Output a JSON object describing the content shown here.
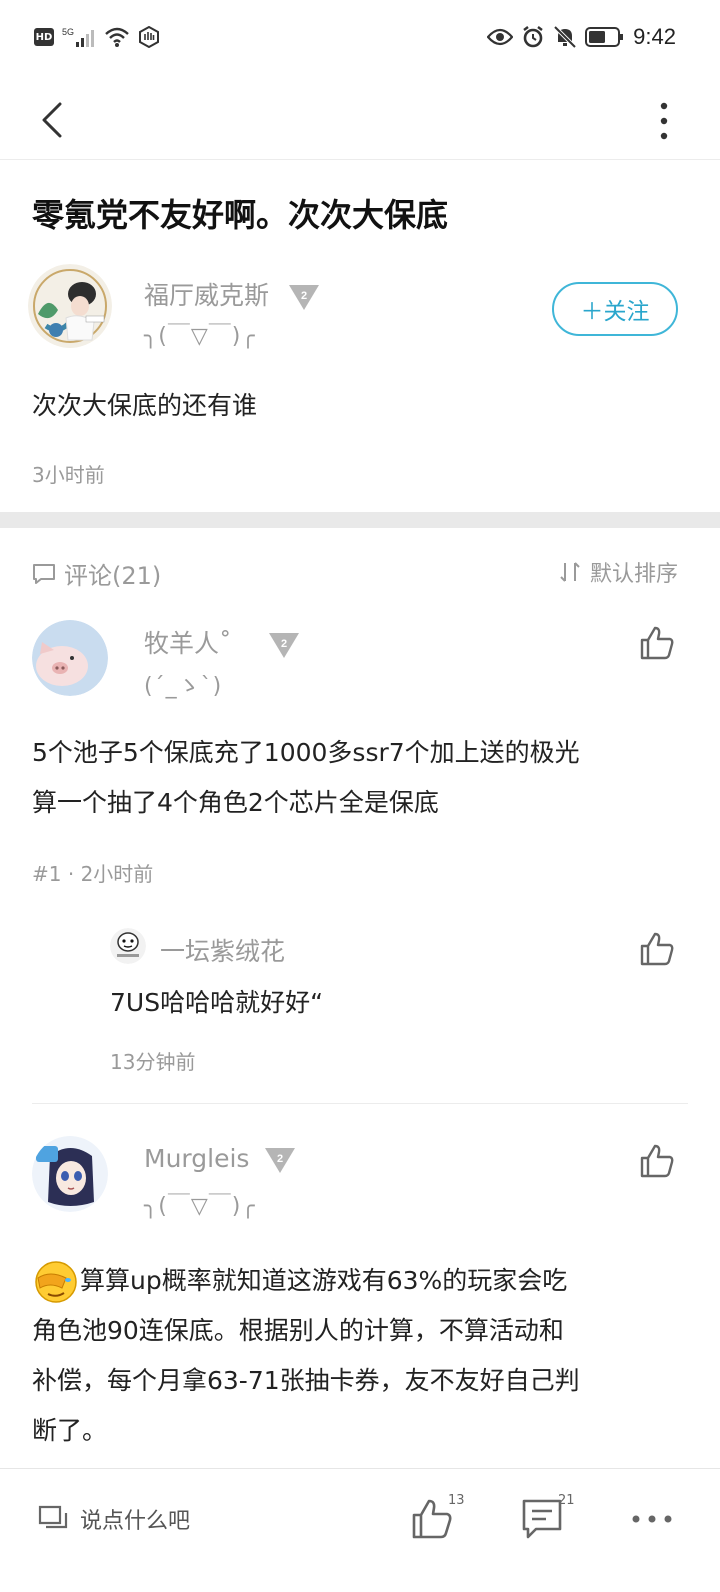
{
  "status_bar": {
    "network": "5G",
    "time": "9:42"
  },
  "post": {
    "title": "零氪党不友好啊。次次大保底",
    "author": {
      "name": "福厅威克斯",
      "signature": "╮(￣▽￣)╭",
      "level": "2"
    },
    "follow_label": "＋关注",
    "body": "次次大保底的还有谁",
    "time": "3小时前"
  },
  "comments_header": {
    "label": "评论(21)",
    "sort_label": "默认排序"
  },
  "comments": [
    {
      "name": "牧羊人˚",
      "level": "2",
      "signature": "(´_ゝ`)",
      "body_line1": "5个池子5个保底充了1000多ssr7个加上送的极光",
      "body_line2": "算一个抽了4个角色2个芯片全是保底",
      "floor": "#1",
      "time": "2小时前",
      "reply": {
        "name": "一坛紫绒花",
        "body": "7US哈哈哈就好好“",
        "time": "13分钟前"
      }
    },
    {
      "name": "Murgleis",
      "level": "2",
      "signature": "╮(￣▽￣)╭",
      "body_line1": "算算up概率就知道这游戏有63%的玩家会吃",
      "body_line2": "角色池90连保底。根据别人的计算，不算活动和",
      "body_line3": "补偿，每个月拿63-71张抽卡券，友不友好自己判",
      "body_line4": "断了。"
    }
  ],
  "bottom_bar": {
    "input_placeholder": "说点什么吧",
    "like_count": "13",
    "comment_count": "21"
  },
  "colors": {
    "accent": "#2aa6cc",
    "muted_text": "#9a9a9a",
    "separator": "#e9e9e9"
  }
}
